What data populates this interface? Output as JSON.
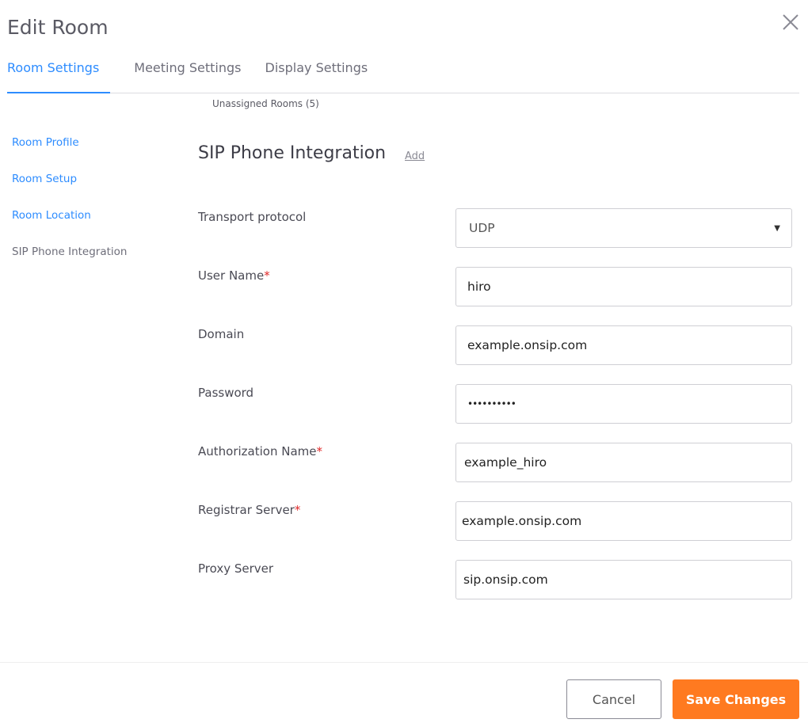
{
  "header": {
    "title": "Edit Room",
    "close_icon": "close-icon"
  },
  "tabs": [
    {
      "label": "Room Settings",
      "active": true
    },
    {
      "label": "Meeting Settings"
    },
    {
      "label": "Display Settings"
    }
  ],
  "unassigned": "Unassigned Rooms (5)",
  "sidebar": {
    "items": [
      {
        "label": "Room Profile"
      },
      {
        "label": "Room Setup"
      },
      {
        "label": "Room Location"
      },
      {
        "label": "SIP Phone Integration",
        "current": true
      }
    ]
  },
  "section": {
    "title": "SIP Phone Integration",
    "add_label": "Add"
  },
  "form": {
    "transport": {
      "label": "Transport protocol",
      "value": "UDP"
    },
    "username": {
      "label": "User Name",
      "value": "hiro",
      "required": "*"
    },
    "domain": {
      "label": "Domain",
      "value": "example.onsip.com"
    },
    "password": {
      "label": "Password",
      "value": "••••••••••"
    },
    "authname": {
      "label": "Authorization Name",
      "value": "example_hiro",
      "required": "*"
    },
    "registrar": {
      "label": "Registrar Server",
      "value": "example.onsip.com",
      "required": "*"
    },
    "proxy": {
      "label": "Proxy Server",
      "value": "sip.onsip.com"
    }
  },
  "footer": {
    "cancel": "Cancel",
    "save": "Save Changes"
  },
  "colors": {
    "accent": "#2d8cff",
    "primary_button": "#ff7a20",
    "required": "#e02828"
  }
}
